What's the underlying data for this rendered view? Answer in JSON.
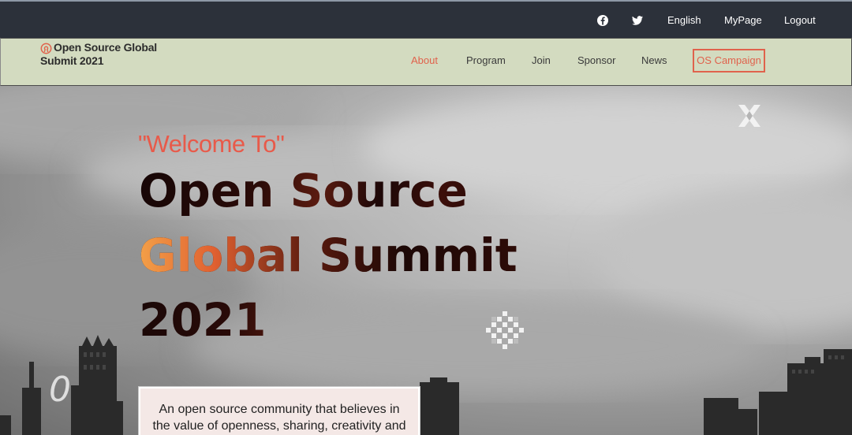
{
  "topbar": {
    "icons": [
      "facebook-icon",
      "twitter-icon"
    ],
    "language_label": "English",
    "mypage_label": "MyPage",
    "logout_label": "Logout"
  },
  "brand": {
    "line1": "Open Source Global",
    "line2": "Submit 2021",
    "icon": "open-source-logo-icon"
  },
  "nav": {
    "items": [
      "About",
      "Program",
      "Join",
      "Sponsor",
      "News"
    ],
    "active": "About",
    "cta_label": "OS Campaign"
  },
  "hero": {
    "welcome": "\"Welcome To\"",
    "headline_line1": "Open Source",
    "headline_line2": "Global Summit",
    "headline_line3": "2021",
    "description": "An open source community that believes in the value of openness, sharing, creativity and",
    "decor_glyph": "0"
  },
  "colors": {
    "accent": "#e0624c",
    "topbar_bg": "#2c313a",
    "nav_bg": "#d3dbc0"
  }
}
